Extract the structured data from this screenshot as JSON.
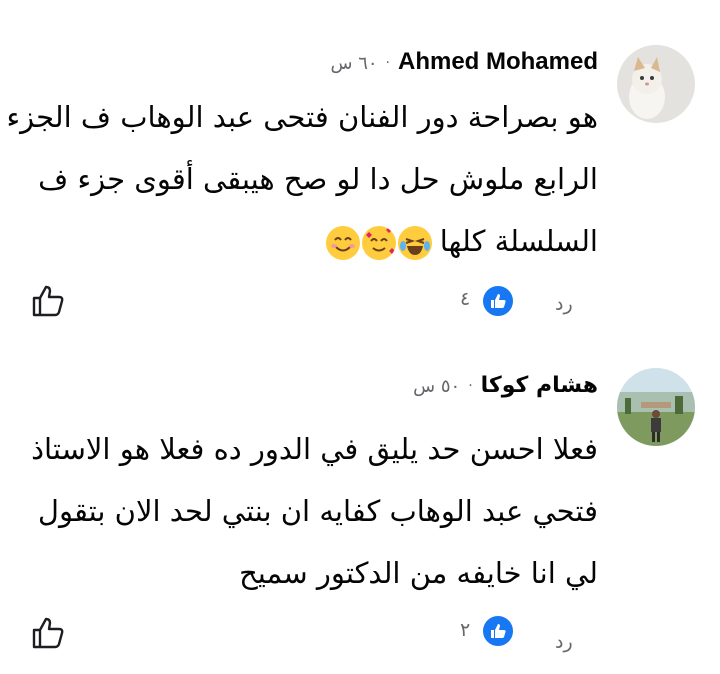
{
  "comments": [
    {
      "author": "Ahmed Mohamed",
      "time": "٦٠ س",
      "text_lines": [
        "هو بصراحة دور الفنان فتحى عبد الوهاب ف الجزء",
        "الرابع ملوش حل دا لو صح هيبقى أقوى جزء ف",
        "السلسلة كلها"
      ],
      "emojis": [
        "face-tears-of-joy",
        "smiling-face-with-hearts",
        "smiling-face-with-smiling-eyes"
      ],
      "reply_label": "رد",
      "like_count": "٤",
      "avatar": "kitten-avatar"
    },
    {
      "author": "هشام كوكا",
      "time": "٥٠ س",
      "text_lines": [
        "فعلا احسن حد يليق في الدور ده فعلا هو الاستاذ",
        "فتحي عبد الوهاب كفايه ان بنتي لحد الان بتقول",
        "لي انا خايفه من الدكتور سميح"
      ],
      "reply_label": "رد",
      "like_count": "٢",
      "avatar": "outdoor-person-avatar"
    }
  ],
  "colors": {
    "text": "#050505",
    "muted": "#65676b",
    "like_blue": "#1877f2",
    "emoji_yellow": "#ffcc3d"
  }
}
